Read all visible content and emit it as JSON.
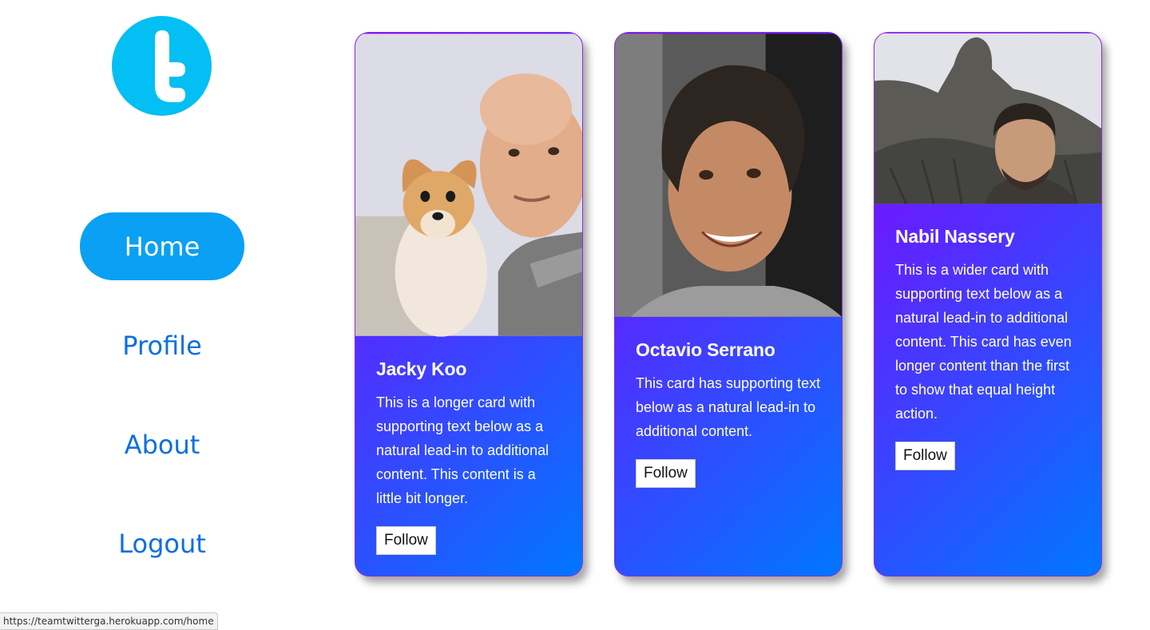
{
  "brand": {
    "logo_icon": "twitter-t-logo-icon",
    "color": "#03bff3"
  },
  "nav": {
    "items": [
      {
        "label": "Home",
        "active": true
      },
      {
        "label": "Profile",
        "active": false
      },
      {
        "label": "About",
        "active": false
      },
      {
        "label": "Logout",
        "active": false
      }
    ],
    "active_color": "#0aa0f4",
    "link_color": "#0b6fe0"
  },
  "cards": [
    {
      "name": "Jacky Koo",
      "text": "This is a longer card with supporting text below as a natural lead-in to additional content. This content is a little bit longer.",
      "button": "Follow",
      "photo": "man-with-dog-photo"
    },
    {
      "name": "Octavio Serrano",
      "text": "This card has supporting text below as a natural lead-in to additional content.",
      "button": "Follow",
      "photo": "smiling-man-portrait-photo"
    },
    {
      "name": "Nabil Nassery",
      "text": "This is a wider card with supporting text below as a natural lead-in to additional content. This card has even longer content than the first to show that equal height action.",
      "button": "Follow",
      "photo": "man-with-statue-photo"
    }
  ],
  "gradient": {
    "start": "#8b00ff",
    "mid": "#4b34ff",
    "end": "#0077ff"
  },
  "status_url": "https://teamtwitterga.herokuapp.com/home"
}
